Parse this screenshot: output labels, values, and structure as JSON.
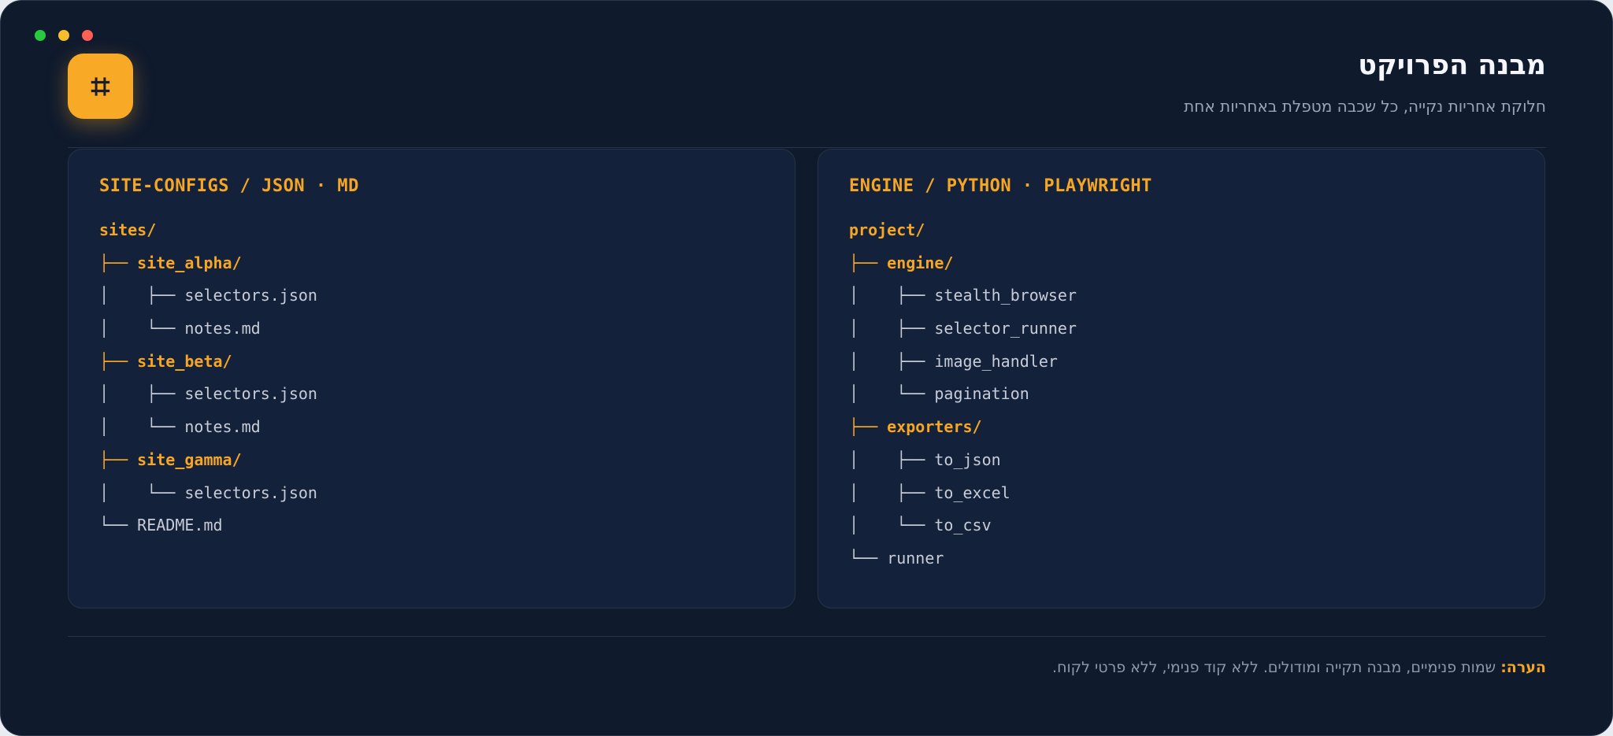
{
  "window": {
    "dots": [
      {
        "name": "green",
        "color": "#27c93f"
      },
      {
        "name": "yellow",
        "color": "#f6be2c"
      },
      {
        "name": "red",
        "color": "#ff5f56"
      }
    ]
  },
  "header": {
    "icon": "hash-icon",
    "icon_glyph": "⌗",
    "title": "מבנה הפרויקט",
    "subtitle": "חלוקת אחריות נקייה, כל שכבה מטפלת באחריות אחת"
  },
  "panels": [
    {
      "id": "site-configs",
      "title": "SITE-CONFIGS / JSON · MD",
      "lines": [
        {
          "prefix": "",
          "name": "sites/",
          "dir": true
        },
        {
          "prefix": "├── ",
          "name": "site_alpha/",
          "dir": true
        },
        {
          "prefix": "│    ├── ",
          "name": "selectors.json",
          "dir": false
        },
        {
          "prefix": "│    └── ",
          "name": "notes.md",
          "dir": false
        },
        {
          "prefix": "├── ",
          "name": "site_beta/",
          "dir": true
        },
        {
          "prefix": "│    ├── ",
          "name": "selectors.json",
          "dir": false
        },
        {
          "prefix": "│    └── ",
          "name": "notes.md",
          "dir": false
        },
        {
          "prefix": "├── ",
          "name": "site_gamma/",
          "dir": true
        },
        {
          "prefix": "│    └── ",
          "name": "selectors.json",
          "dir": false
        },
        {
          "prefix": "└── ",
          "name": "README.md",
          "dir": false
        }
      ]
    },
    {
      "id": "engine",
      "title": "ENGINE / PYTHON · PLAYWRIGHT",
      "lines": [
        {
          "prefix": "",
          "name": "project/",
          "dir": true
        },
        {
          "prefix": "├── ",
          "name": "engine/",
          "dir": true
        },
        {
          "prefix": "│    ├── ",
          "name": "stealth_browser",
          "dir": false
        },
        {
          "prefix": "│    ├── ",
          "name": "selector_runner",
          "dir": false
        },
        {
          "prefix": "│    ├── ",
          "name": "image_handler",
          "dir": false
        },
        {
          "prefix": "│    └── ",
          "name": "pagination",
          "dir": false
        },
        {
          "prefix": "├── ",
          "name": "exporters/",
          "dir": true
        },
        {
          "prefix": "│    ├── ",
          "name": "to_json",
          "dir": false
        },
        {
          "prefix": "│    ├── ",
          "name": "to_excel",
          "dir": false
        },
        {
          "prefix": "│    └── ",
          "name": "to_csv",
          "dir": false
        },
        {
          "prefix": "└── ",
          "name": "runner",
          "dir": false
        }
      ]
    }
  ],
  "footer": {
    "label": "הערה:",
    "text": " שמות פנימיים, מבנה תקייה ומודולים. ללא קוד פנימי, ללא פרטי לקוח."
  }
}
